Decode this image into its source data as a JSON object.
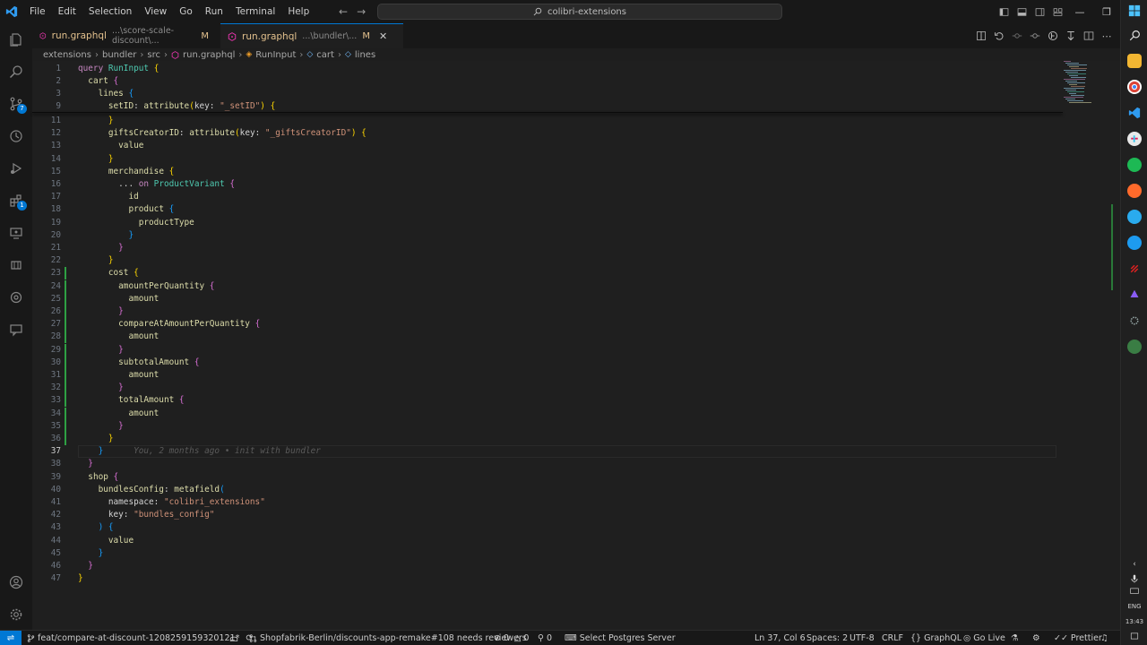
{
  "menu": [
    "File",
    "Edit",
    "Selection",
    "View",
    "Go",
    "Run",
    "Terminal",
    "Help"
  ],
  "search": {
    "text": "colibri-extensions"
  },
  "tabs": [
    {
      "name": "run.graphql",
      "path": "...\\score-scale-discount\\...",
      "status": "M"
    },
    {
      "name": "run.graphql",
      "path": "...\\bundler\\...",
      "status": "M"
    }
  ],
  "breadcrumb": [
    "extensions",
    "bundler",
    "src",
    "run.graphql",
    "RunInput",
    "cart",
    "lines"
  ],
  "lines": [
    {
      "n": "1",
      "t": [
        [
          "kw",
          "query "
        ],
        [
          "tp",
          "RunInput "
        ],
        [
          "b1",
          "{"
        ]
      ]
    },
    {
      "n": "2",
      "t": [
        [
          "plain",
          "  "
        ],
        [
          "fld",
          "cart "
        ],
        [
          "b2",
          "{"
        ]
      ]
    },
    {
      "n": "3",
      "t": [
        [
          "plain",
          "    "
        ],
        [
          "fld",
          "lines "
        ],
        [
          "b3",
          "{"
        ]
      ]
    },
    {
      "n": "9",
      "t": [
        [
          "plain",
          "      "
        ],
        [
          "fld",
          "setID"
        ],
        [
          "plain",
          ": "
        ],
        [
          "fn",
          "attribute"
        ],
        [
          "b1",
          "("
        ],
        [
          "plain",
          "key: "
        ],
        [
          "str",
          "\"_setID\""
        ],
        [
          "b1",
          ")"
        ],
        [
          "plain",
          " "
        ],
        [
          "b1",
          "{"
        ]
      ]
    },
    {
      "n": "11",
      "t": [
        [
          "plain",
          "      "
        ],
        [
          "b1",
          "}"
        ]
      ]
    },
    {
      "n": "12",
      "t": [
        [
          "plain",
          "      "
        ],
        [
          "fld",
          "giftsCreatorID"
        ],
        [
          "plain",
          ": "
        ],
        [
          "fn",
          "attribute"
        ],
        [
          "b1",
          "("
        ],
        [
          "plain",
          "key: "
        ],
        [
          "str",
          "\"_giftsCreatorID\""
        ],
        [
          "b1",
          ")"
        ],
        [
          "plain",
          " "
        ],
        [
          "b1",
          "{"
        ]
      ]
    },
    {
      "n": "13",
      "t": [
        [
          "plain",
          "        "
        ],
        [
          "fld",
          "value"
        ]
      ]
    },
    {
      "n": "14",
      "t": [
        [
          "plain",
          "      "
        ],
        [
          "b1",
          "}"
        ]
      ]
    },
    {
      "n": "15",
      "t": [
        [
          "plain",
          "      "
        ],
        [
          "fld",
          "merchandise "
        ],
        [
          "b1",
          "{"
        ]
      ]
    },
    {
      "n": "16",
      "t": [
        [
          "plain",
          "        ... "
        ],
        [
          "kw",
          "on "
        ],
        [
          "tp",
          "ProductVariant "
        ],
        [
          "b2",
          "{"
        ]
      ]
    },
    {
      "n": "17",
      "t": [
        [
          "plain",
          "          "
        ],
        [
          "fld",
          "id"
        ]
      ]
    },
    {
      "n": "18",
      "t": [
        [
          "plain",
          "          "
        ],
        [
          "fld",
          "product "
        ],
        [
          "b3",
          "{"
        ]
      ]
    },
    {
      "n": "19",
      "t": [
        [
          "plain",
          "            "
        ],
        [
          "fld",
          "productType"
        ]
      ]
    },
    {
      "n": "20",
      "t": [
        [
          "plain",
          "          "
        ],
        [
          "b3",
          "}"
        ]
      ]
    },
    {
      "n": "21",
      "t": [
        [
          "plain",
          "        "
        ],
        [
          "b2",
          "}"
        ]
      ]
    },
    {
      "n": "22",
      "t": [
        [
          "plain",
          "      "
        ],
        [
          "b1",
          "}"
        ]
      ]
    },
    {
      "n": "23",
      "t": [
        [
          "plain",
          "      "
        ],
        [
          "fld",
          "cost "
        ],
        [
          "b1",
          "{"
        ]
      ]
    },
    {
      "n": "24",
      "t": [
        [
          "plain",
          "        "
        ],
        [
          "fld",
          "amountPerQuantity "
        ],
        [
          "b2",
          "{"
        ]
      ]
    },
    {
      "n": "25",
      "t": [
        [
          "plain",
          "          "
        ],
        [
          "fld",
          "amount"
        ]
      ]
    },
    {
      "n": "26",
      "t": [
        [
          "plain",
          "        "
        ],
        [
          "b2",
          "}"
        ]
      ]
    },
    {
      "n": "27",
      "t": [
        [
          "plain",
          "        "
        ],
        [
          "fld",
          "compareAtAmountPerQuantity "
        ],
        [
          "b2",
          "{"
        ]
      ]
    },
    {
      "n": "28",
      "t": [
        [
          "plain",
          "          "
        ],
        [
          "fld",
          "amount"
        ]
      ]
    },
    {
      "n": "29",
      "t": [
        [
          "plain",
          "        "
        ],
        [
          "b2",
          "}"
        ]
      ]
    },
    {
      "n": "30",
      "t": [
        [
          "plain",
          "        "
        ],
        [
          "fld",
          "subtotalAmount "
        ],
        [
          "b2",
          "{"
        ]
      ]
    },
    {
      "n": "31",
      "t": [
        [
          "plain",
          "          "
        ],
        [
          "fld",
          "amount"
        ]
      ]
    },
    {
      "n": "32",
      "t": [
        [
          "plain",
          "        "
        ],
        [
          "b2",
          "}"
        ]
      ]
    },
    {
      "n": "33",
      "t": [
        [
          "plain",
          "        "
        ],
        [
          "fld",
          "totalAmount "
        ],
        [
          "b2",
          "{"
        ]
      ]
    },
    {
      "n": "34",
      "t": [
        [
          "plain",
          "          "
        ],
        [
          "fld",
          "amount"
        ]
      ]
    },
    {
      "n": "35",
      "t": [
        [
          "plain",
          "        "
        ],
        [
          "b2",
          "}"
        ]
      ]
    },
    {
      "n": "36",
      "t": [
        [
          "plain",
          "      "
        ],
        [
          "b1",
          "}"
        ]
      ]
    },
    {
      "n": "37",
      "t": [
        [
          "plain",
          "    "
        ],
        [
          "b3",
          "}"
        ],
        [
          "blame",
          "      You, 2 months ago • init with bundler"
        ]
      ]
    },
    {
      "n": "38",
      "t": [
        [
          "plain",
          "  "
        ],
        [
          "b2",
          "}"
        ]
      ]
    },
    {
      "n": "39",
      "t": [
        [
          "plain",
          "  "
        ],
        [
          "fld",
          "shop "
        ],
        [
          "b2",
          "{"
        ]
      ]
    },
    {
      "n": "40",
      "t": [
        [
          "plain",
          "    "
        ],
        [
          "fld",
          "bundlesConfig"
        ],
        [
          "plain",
          ": "
        ],
        [
          "fn",
          "metafield"
        ],
        [
          "b3",
          "("
        ]
      ]
    },
    {
      "n": "41",
      "t": [
        [
          "plain",
          "      namespace: "
        ],
        [
          "str",
          "\"colibri_extensions\""
        ]
      ]
    },
    {
      "n": "42",
      "t": [
        [
          "plain",
          "      key: "
        ],
        [
          "str",
          "\"bundles_config\""
        ]
      ]
    },
    {
      "n": "43",
      "t": [
        [
          "plain",
          "    "
        ],
        [
          "b3",
          ")"
        ],
        [
          "plain",
          " "
        ],
        [
          "b3",
          "{"
        ]
      ]
    },
    {
      "n": "44",
      "t": [
        [
          "plain",
          "      "
        ],
        [
          "fld",
          "value"
        ]
      ]
    },
    {
      "n": "45",
      "t": [
        [
          "plain",
          "    "
        ],
        [
          "b3",
          "}"
        ]
      ]
    },
    {
      "n": "46",
      "t": [
        [
          "plain",
          "  "
        ],
        [
          "b2",
          "}"
        ]
      ]
    },
    {
      "n": "47",
      "t": [
        [
          "b1",
          "}"
        ]
      ]
    }
  ],
  "activity_badges": {
    "source_control": "7",
    "extensions": "1"
  },
  "status": {
    "branch": "feat/compare-at-discount-1208259159320121*",
    "pr": "Shopfabrik-Berlin/discounts-app-remake#108 needs reviewers",
    "errors": "0",
    "warnings": "0",
    "ports": "0",
    "postgres": "Select Postgres Server",
    "position": "Ln 37, Col 6",
    "spaces": "Spaces: 2",
    "encoding": "UTF-8",
    "eol": "CRLF",
    "language": "GraphQL",
    "golive": "Go Live",
    "prettier": "Prettier"
  },
  "taskbar": {
    "lang": "ENG",
    "time": "13:43"
  },
  "colors": {
    "accent": "#0078d4",
    "modified": "#e2c08d",
    "added": "#2ea043"
  }
}
